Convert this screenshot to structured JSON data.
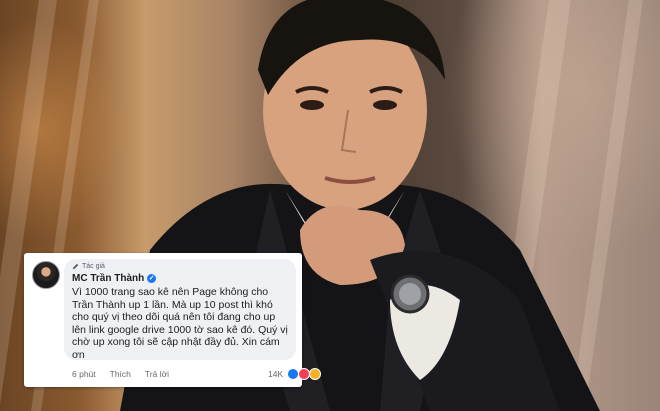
{
  "comment": {
    "author_tag": "Tác giả",
    "author_name": "MC Trần Thành",
    "text": "Vì 1000 trang sao kê nên Page không cho Trần Thành up 1 lần. Mà up 10 post thì khó cho quý vị theo dõi quá nên tôi đang cho up lên link google drive 1000 tờ sao kê đó. Quý vị chờ up xong tôi sẽ cập nhật đầy đủ. Xin cám ơn",
    "time": "6 phút",
    "like_label": "Thích",
    "reply_label": "Trả lời",
    "reaction_count": "14K",
    "reaction_icons": [
      "like-icon",
      "love-icon",
      "haha-icon"
    ]
  },
  "colors": {
    "verified": "#1877f2",
    "bubble": "#eef0f3",
    "like": "#1877f2",
    "love": "#f33e58",
    "haha": "#f7b125"
  }
}
